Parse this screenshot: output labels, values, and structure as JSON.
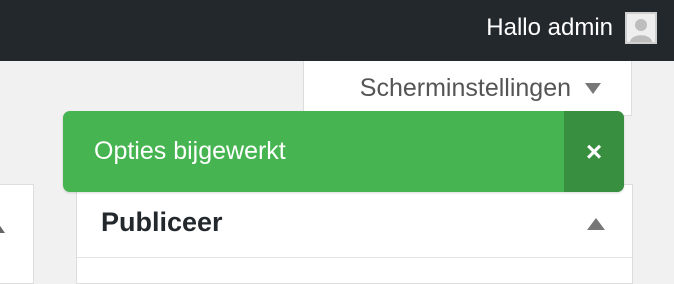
{
  "adminbar": {
    "greeting": "Hallo admin",
    "avatar_icon": "user-avatar-icon",
    "background": "#23282d"
  },
  "screen_options": {
    "label": "Scherminstellingen",
    "toggle_icon": "triangle-down-icon"
  },
  "notice": {
    "message": "Opties bijgewerkt",
    "dismiss_glyph": "×",
    "dismiss_icon": "close-icon",
    "color": "#46b450",
    "dismiss_color": "#398f40"
  },
  "metabox": {
    "title": "Publiceer",
    "toggle_icon": "triangle-up-icon"
  }
}
